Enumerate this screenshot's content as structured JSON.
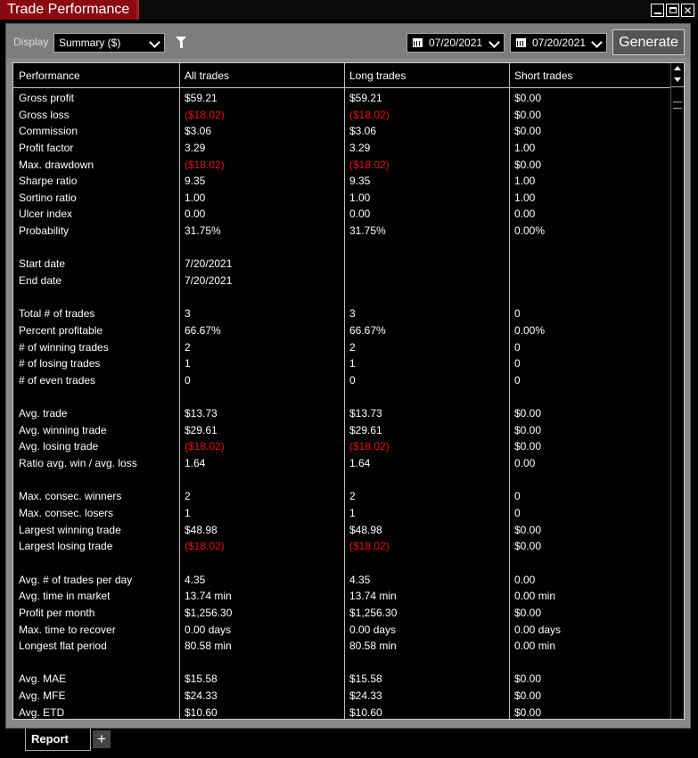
{
  "window": {
    "title": "Trade Performance"
  },
  "toolbar": {
    "display_label": "Display",
    "display_value": "Summary ($)",
    "from_date": "07/20/2021",
    "to_date": "07/20/2021",
    "generate_label": "Generate"
  },
  "table": {
    "headers": [
      "Performance",
      "All trades",
      "Long trades",
      "Short trades"
    ],
    "rows": [
      [
        "Gross profit",
        "$59.21",
        "$59.21",
        "$0.00"
      ],
      [
        "Gross loss",
        "($18.02)",
        "($18.02)",
        "$0.00"
      ],
      [
        "Commission",
        "$3.06",
        "$3.06",
        "$0.00"
      ],
      [
        "Profit factor",
        "3.29",
        "3.29",
        "1.00"
      ],
      [
        "Max. drawdown",
        "($18.02)",
        "($18.02)",
        "$0.00"
      ],
      [
        "Sharpe ratio",
        "9.35",
        "9.35",
        "1.00"
      ],
      [
        "Sortino ratio",
        "1.00",
        "1.00",
        "1.00"
      ],
      [
        "Ulcer index",
        "0.00",
        "0.00",
        "0.00"
      ],
      [
        "Probability",
        "31.75%",
        "31.75%",
        "0.00%"
      ],
      [
        "",
        "",
        "",
        ""
      ],
      [
        "Start date",
        "7/20/2021",
        "",
        ""
      ],
      [
        "End date",
        "7/20/2021",
        "",
        ""
      ],
      [
        "",
        "",
        "",
        ""
      ],
      [
        "Total # of trades",
        "3",
        "3",
        "0"
      ],
      [
        "Percent profitable",
        "66.67%",
        "66.67%",
        "0.00%"
      ],
      [
        "# of winning trades",
        "2",
        "2",
        "0"
      ],
      [
        "# of losing trades",
        "1",
        "1",
        "0"
      ],
      [
        "# of even trades",
        "0",
        "0",
        "0"
      ],
      [
        "",
        "",
        "",
        ""
      ],
      [
        "Avg. trade",
        "$13.73",
        "$13.73",
        "$0.00"
      ],
      [
        "Avg. winning trade",
        "$29.61",
        "$29.61",
        "$0.00"
      ],
      [
        "Avg. losing trade",
        "($18.02)",
        "($18.02)",
        "$0.00"
      ],
      [
        "Ratio avg. win / avg. loss",
        "1.64",
        "1.64",
        "0.00"
      ],
      [
        "",
        "",
        "",
        ""
      ],
      [
        "Max. consec. winners",
        "2",
        "2",
        "0"
      ],
      [
        "Max. consec. losers",
        "1",
        "1",
        "0"
      ],
      [
        "Largest winning trade",
        "$48.98",
        "$48.98",
        "$0.00"
      ],
      [
        "Largest losing trade",
        "($18.02)",
        "($18.02)",
        "$0.00"
      ],
      [
        "",
        "",
        "",
        ""
      ],
      [
        "Avg. # of trades per day",
        "4.35",
        "4.35",
        "0.00"
      ],
      [
        "Avg. time in market",
        "13.74 min",
        "13.74 min",
        "0.00 min"
      ],
      [
        "Profit per month",
        "$1,256.30",
        "$1,256.30",
        "$0.00"
      ],
      [
        "Max. time to recover",
        "0.00 days",
        "0.00 days",
        "0.00 days"
      ],
      [
        "Longest flat period",
        "80.58 min",
        "80.58 min",
        "0.00 min"
      ],
      [
        "",
        "",
        "",
        ""
      ],
      [
        "Avg. MAE",
        "$15.58",
        "$15.58",
        "$0.00"
      ],
      [
        "Avg. MFE",
        "$24.33",
        "$24.33",
        "$0.00"
      ],
      [
        "Avg. ETD",
        "$10.60",
        "$10.60",
        "$0.00"
      ]
    ]
  },
  "tabs": {
    "report_label": "Report",
    "add_label": "+"
  },
  "colors": {
    "title_accent": "#8b0a12",
    "negative": "#e8101a"
  }
}
